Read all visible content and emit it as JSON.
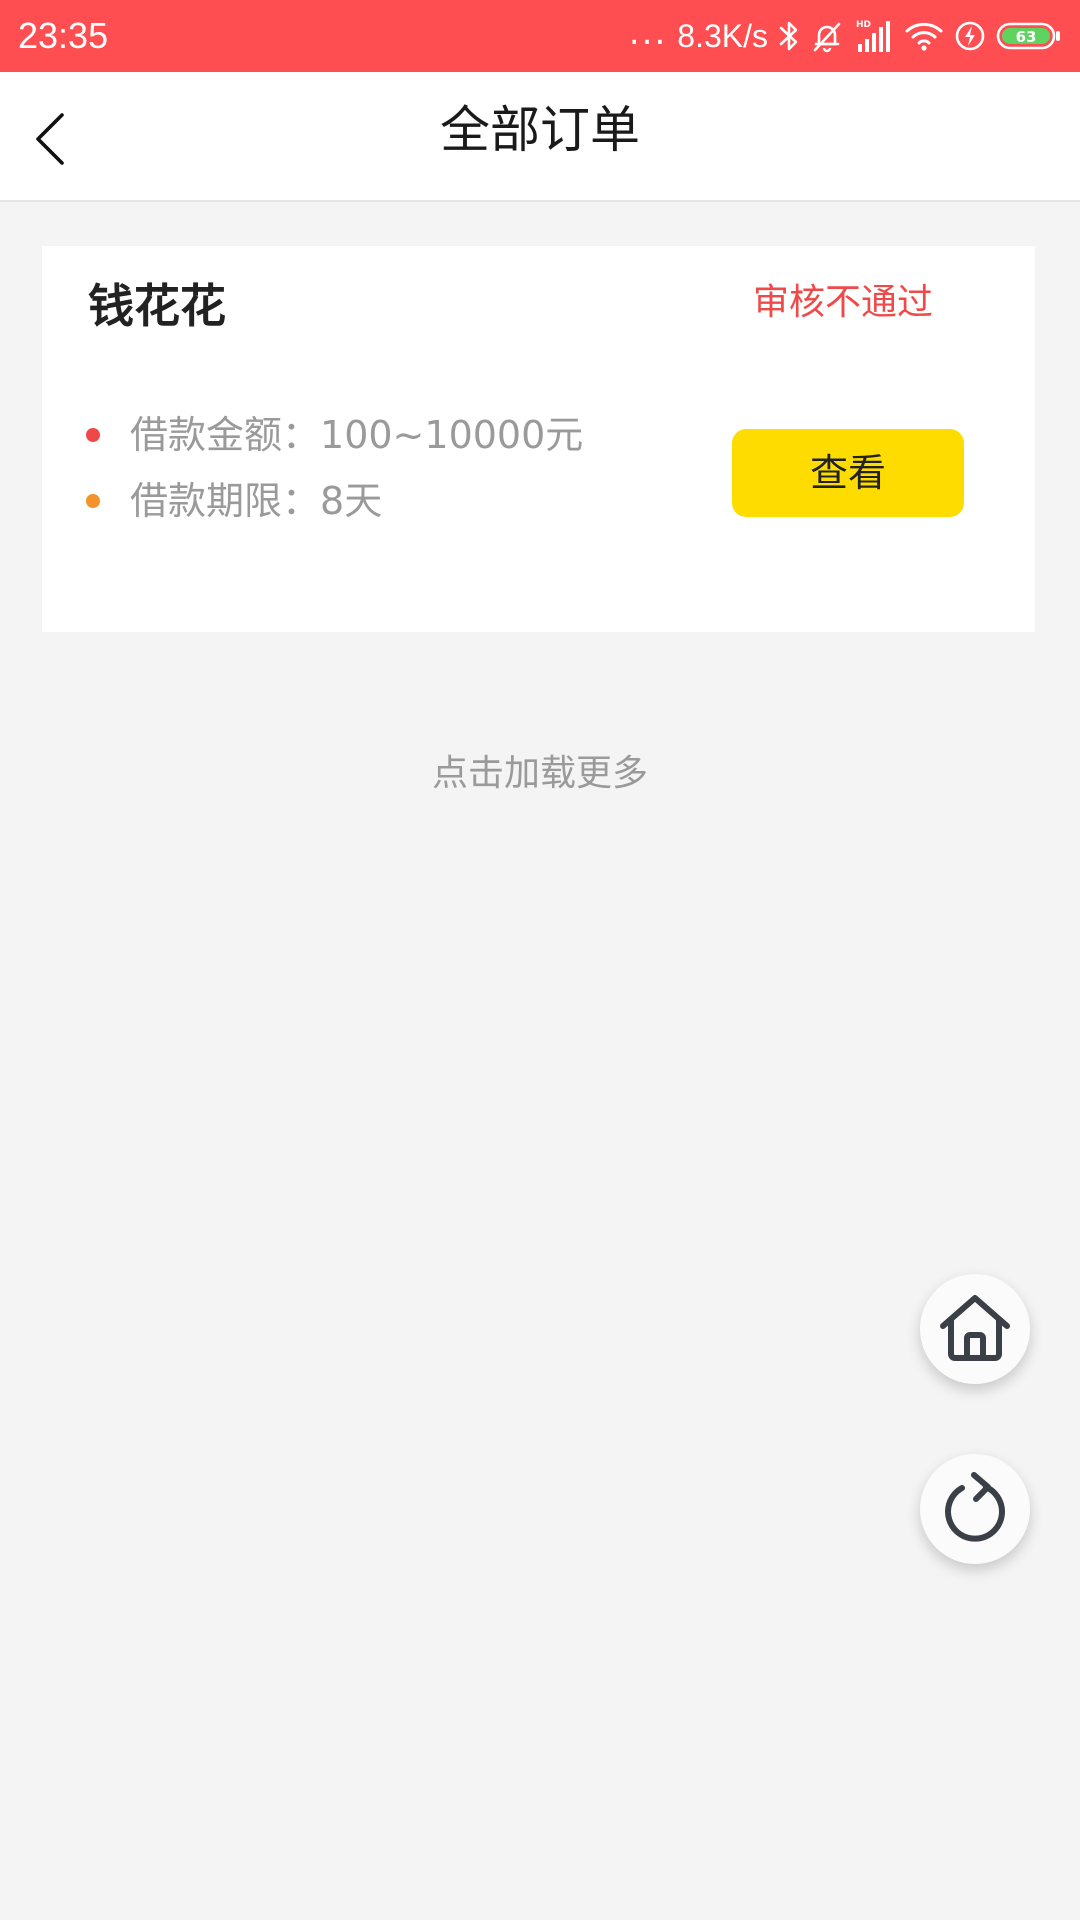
{
  "status_bar": {
    "time": "23:35",
    "dots": "...",
    "network_speed": "8.3K/s",
    "icons": [
      "bluetooth-icon",
      "alarm-off-icon",
      "hd-signal-icon",
      "wifi-icon",
      "charging-icon",
      "battery-icon"
    ],
    "hd_label": "HD",
    "battery_level": "63",
    "background_color": "#fe4e51"
  },
  "header": {
    "back_icon": "chevron-left-icon",
    "title": "全部订单"
  },
  "orders": [
    {
      "product_name": "钱花花",
      "status": "审核不通过",
      "status_color": "#ef4a4a",
      "amount_label": "借款金额：",
      "amount_value": "100~10000元",
      "amount_bullet_color": "#f04848",
      "term_label": "借款期限：",
      "term_value": "8天",
      "term_bullet_color": "#f5922a",
      "action_label": "查看",
      "action_color": "#ffdc00"
    }
  ],
  "load_more": "点击加载更多",
  "floating_buttons": {
    "home_icon": "home-icon",
    "refresh_icon": "refresh-icon"
  }
}
